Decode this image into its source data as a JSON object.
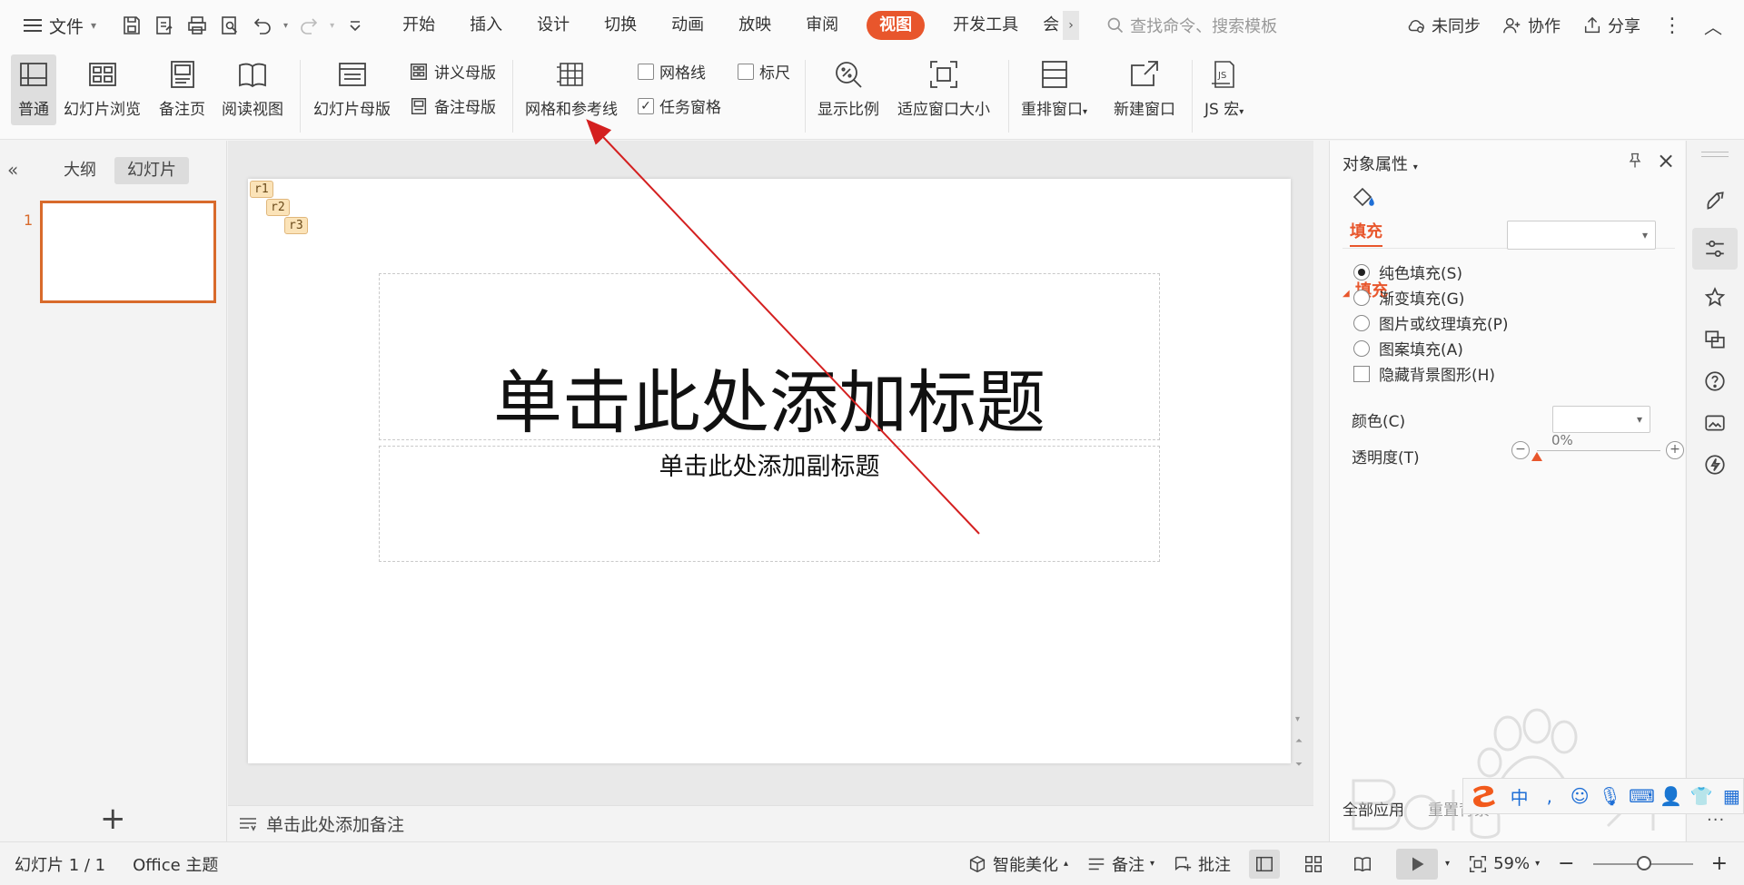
{
  "menubar": {
    "file_label": "文件",
    "tabs": [
      {
        "label": "开始"
      },
      {
        "label": "插入"
      },
      {
        "label": "设计"
      },
      {
        "label": "切换"
      },
      {
        "label": "动画"
      },
      {
        "label": "放映"
      },
      {
        "label": "审阅"
      },
      {
        "label": "视图"
      },
      {
        "label": "开发工具"
      },
      {
        "label": "会"
      }
    ],
    "active_tab": "视图",
    "search_placeholder": "查找命令、搜索模板",
    "right": {
      "sync_label": "未同步",
      "collab_label": "协作",
      "share_label": "分享"
    }
  },
  "ribbon": {
    "normal": "普通",
    "slide_browse": "幻灯片浏览",
    "notes_page": "备注页",
    "reading_view": "阅读视图",
    "slide_master": "幻灯片母版",
    "handout_master": "讲义母版",
    "notes_master": "备注母版",
    "grid_guides": "网格和参考线",
    "gridlines": "网格线",
    "gridlines_checked": false,
    "ruler": "标尺",
    "ruler_checked": false,
    "task_pane": "任务窗格",
    "task_pane_checked": true,
    "zoom": "显示比例",
    "fit_window": "适应窗口大小",
    "arrange_window": "重排窗口",
    "new_window": "新建窗口",
    "js_macro": "JS 宏"
  },
  "left_panel": {
    "tab_outline": "大纲",
    "tab_slides": "幻灯片",
    "active_tab": "幻灯片",
    "slide_number": "1",
    "add_icon": "+"
  },
  "slide": {
    "tags": [
      "r1",
      "r2",
      "r3"
    ],
    "title_placeholder": "单击此处添加标题",
    "subtitle_placeholder": "单击此处添加副标题"
  },
  "notes": {
    "placeholder": "单击此处添加备注"
  },
  "property_panel": {
    "title": "对象属性",
    "fill_tab": "填充",
    "fill_section": "填充",
    "fill_options": [
      {
        "label": "纯色填充(S)",
        "selected": true
      },
      {
        "label": "渐变填充(G)",
        "selected": false
      },
      {
        "label": "图片或纹理填充(P)",
        "selected": false
      },
      {
        "label": "图案填充(A)",
        "selected": false
      }
    ],
    "hide_bg_label": "隐藏背景图形(H)",
    "color_label": "颜色(C)",
    "transparency_label": "透明度(T)",
    "transparency_value": "0%",
    "bottom_tabs": [
      "全部应用",
      "重置背景"
    ]
  },
  "statusbar": {
    "slide_info": "幻灯片 1 / 1",
    "theme": "Office 主题",
    "smart_beautify": "智能美化",
    "notes": "备注",
    "comments": "批注",
    "zoom": "59%"
  },
  "colors": {
    "accent": "#e8562c",
    "thumb_border": "#d86a2b",
    "annotation_arrow": "#d42020"
  }
}
